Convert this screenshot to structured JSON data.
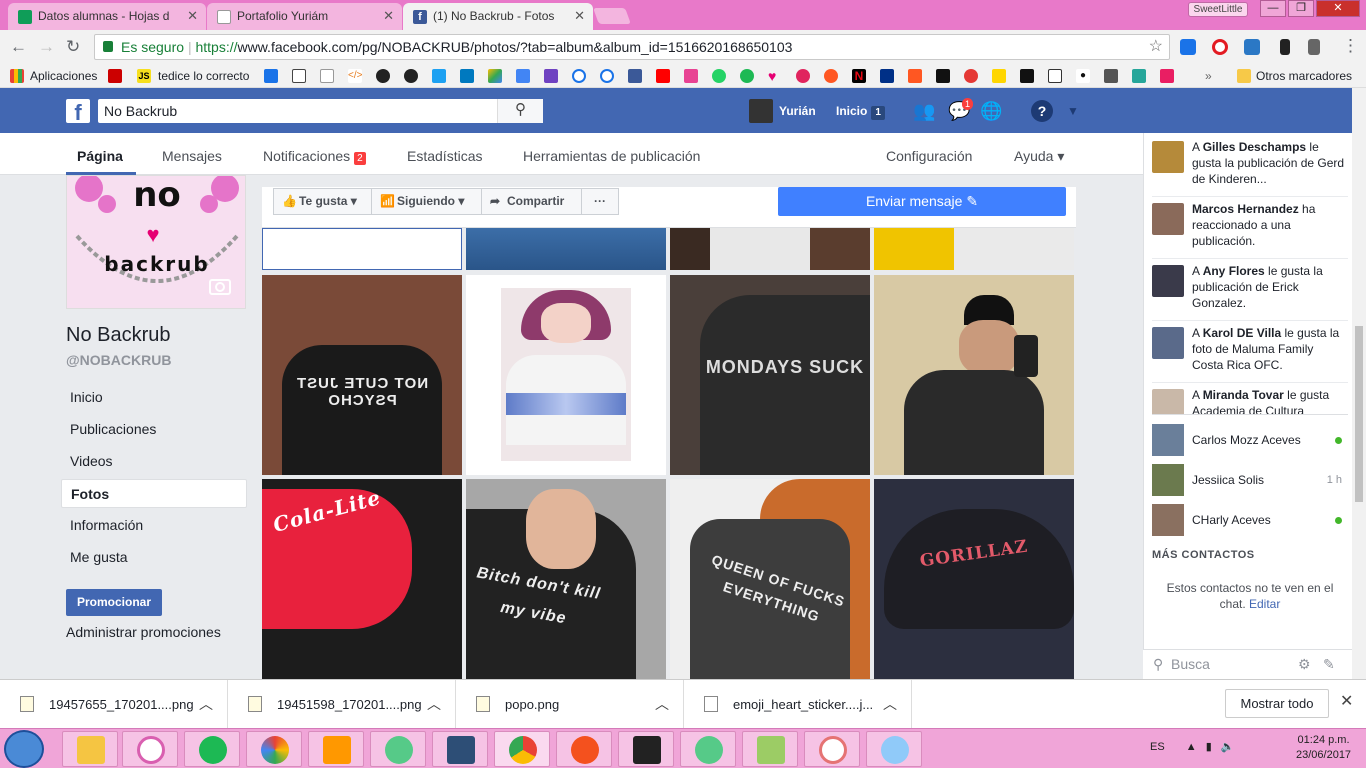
{
  "browser": {
    "tabs": [
      {
        "title": "Datos alumnas - Hojas d",
        "icon": "sheets-icon",
        "color": "#0f9d58"
      },
      {
        "title": "Portafolio Yuriám",
        "icon": "doc-icon",
        "color": "#999999"
      },
      {
        "title": "(1) No Backrub - Fotos",
        "icon": "facebook-icon",
        "color": "#3b5998"
      }
    ],
    "profile_name": "SweetLittle",
    "secure_label": "Es seguro",
    "url_scheme": "https://",
    "url_rest": "www.facebook.com/pg/NOBACKRUB/photos/?tab=album&album_id=1516620168650103",
    "bookmarks": [
      "Aplicaciones",
      "tedice lo correcto"
    ],
    "other_bookmarks": "Otros marcadores"
  },
  "fb": {
    "search_value": "No Backrub",
    "user_name": "Yurián",
    "home_label": "Inicio",
    "home_count": "1",
    "messages_badge": "1"
  },
  "page_tabs": {
    "pagina": "Página",
    "mensajes": "Mensajes",
    "notificaciones": "Notificaciones",
    "notif_count": "2",
    "estadisticas": "Estadísticas",
    "herramientas": "Herramientas de publicación",
    "configuracion": "Configuración",
    "ayuda": "Ayuda ▾"
  },
  "page": {
    "name": "No Backrub",
    "handle": "@NOBACKRUB",
    "logo_text_top": "no",
    "logo_text_bottom": "backrub",
    "nav": [
      "Inicio",
      "Publicaciones",
      "Videos",
      "Fotos",
      "Información",
      "Me gusta"
    ],
    "active_nav": "Fotos",
    "promote_label": "Promocionar",
    "admin_promo_label": "Administrar promociones"
  },
  "actions": {
    "like": "Te gusta",
    "following": "Siguiendo",
    "share": "Compartir",
    "more": "···",
    "send_message": "Enviar mensaje"
  },
  "photos": [
    {
      "caption": "NOT CUTE JUST PSYCHO",
      "shirt": "#1a1a1a",
      "bg": "#7a4a38"
    },
    {
      "caption": "",
      "shirt": "#f4f4f4",
      "bg": "#efe6e8"
    },
    {
      "caption": "MONDAYS SUCK",
      "shirt": "#2b2b2b",
      "bg": "#4a3f3a"
    },
    {
      "caption": "",
      "shirt": "#2a2a2a",
      "bg": "#d8c9a4"
    },
    {
      "caption": "Cola-Lite",
      "shirt": "#e8213d",
      "bg": "#1c1c1c"
    },
    {
      "caption": "Bitch don't kill my vibe",
      "shirt": "#222222",
      "bg": "#a7a7a7"
    },
    {
      "caption": "QUEEN OF FUCKS EVERYTHING",
      "shirt": "#3d3d3d",
      "bg": "#c96b2c"
    },
    {
      "caption": "GORILLAZ",
      "shirt": "#1e1e24",
      "bg": "#2c2f3f"
    }
  ],
  "ticker": [
    {
      "prefix": "A ",
      "name": "Gilles Deschamps",
      "rest": " le gusta la publicación de Gerd de Kinderen..."
    },
    {
      "prefix": "",
      "name": "Marcos Hernandez",
      "rest": " ha reaccionado a una publicación."
    },
    {
      "prefix": "A ",
      "name": "Any Flores",
      "rest": " le gusta la publicación de Erick Gonzalez."
    },
    {
      "prefix": "A ",
      "name": "Karol DE Villa",
      "rest": " le gusta la foto de Maluma Family Costa Rica OFC."
    },
    {
      "prefix": "A ",
      "name": "Miranda Tovar",
      "rest": " le gusta Academia de Cultura"
    }
  ],
  "contacts": [
    {
      "name": "Carlos Mozz Aceves",
      "status": "online",
      "time": ""
    },
    {
      "name": "Jessiica Solis",
      "status": "idle",
      "time": "1 h"
    },
    {
      "name": "CHarly Aceves",
      "status": "online",
      "time": ""
    }
  ],
  "more_contacts": "MÁS CONTACTOS",
  "chat_off_text": "Estos contactos no te ven en el chat.",
  "chat_edit": "Editar",
  "chat_search_placeholder": "Busca",
  "downloads": [
    {
      "name": "19457655_170201....png"
    },
    {
      "name": "19451598_170201....png"
    },
    {
      "name": "popo.png"
    },
    {
      "name": "emoji_heart_sticker....j..."
    }
  ],
  "show_all": "Mostrar todo",
  "system": {
    "lang": "ES",
    "time": "01:24 p.m.",
    "date": "23/06/2017"
  },
  "colors": {
    "fb_blue": "#4267b2",
    "messenger_blue": "#4080ff",
    "taskbar_pink": "#f0a5d8",
    "tabbar_pink": "#e879c9"
  }
}
